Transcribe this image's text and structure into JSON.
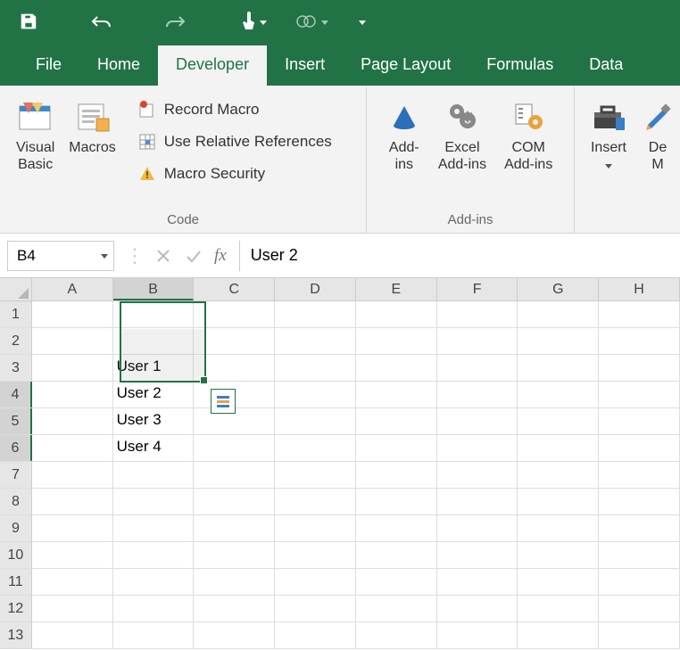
{
  "qat": {
    "save": "save-icon",
    "undo": "undo-icon",
    "redo": "redo-icon",
    "touch": "touch-icon",
    "tool": "shape-icon",
    "more": "more-icon"
  },
  "tabs": {
    "file": "File",
    "home": "Home",
    "developer": "Developer",
    "insert": "Insert",
    "pagelayout": "Page Layout",
    "formulas": "Formulas",
    "data": "Data",
    "active": "developer"
  },
  "ribbon": {
    "code": {
      "visualbasic": "Visual\nBasic",
      "macros": "Macros",
      "record": "Record Macro",
      "relative": "Use Relative References",
      "security": "Macro Security",
      "group": "Code"
    },
    "addins": {
      "addins": "Add-\nins",
      "excel": "Excel\nAdd-ins",
      "com": "COM\nAdd-ins",
      "group": "Add-ins"
    },
    "controls": {
      "insert": "Insert",
      "design": "De\nM"
    }
  },
  "formula": {
    "namebox": "B4",
    "fx": "fx",
    "value": "User 2"
  },
  "columns": [
    "A",
    "B",
    "C",
    "D",
    "E",
    "F",
    "G",
    "H"
  ],
  "rowcount": 13,
  "cells": {
    "B3": "User 1",
    "B4": "User 2",
    "B5": "User 3",
    "B6": "User 4"
  },
  "selection": {
    "col": "B",
    "rowStart": 4,
    "rowEnd": 6
  }
}
